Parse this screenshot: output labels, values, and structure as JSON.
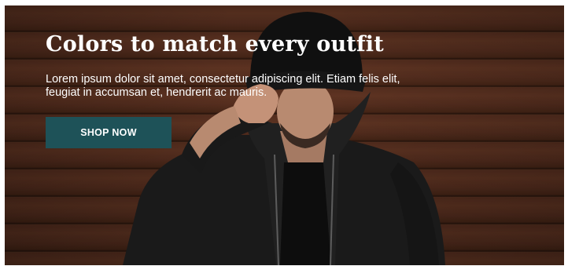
{
  "hero": {
    "headline": "Colors to match every outfit",
    "description": "Lorem ipsum dolor sit amet, consectetur adipiscing elit. Etiam felis elit, feugiat in accumsan et, hendrerit ac mauris.",
    "cta_label": "SHOP NOW",
    "cta_color": "#1e5258",
    "background_color": "#5a3020"
  }
}
